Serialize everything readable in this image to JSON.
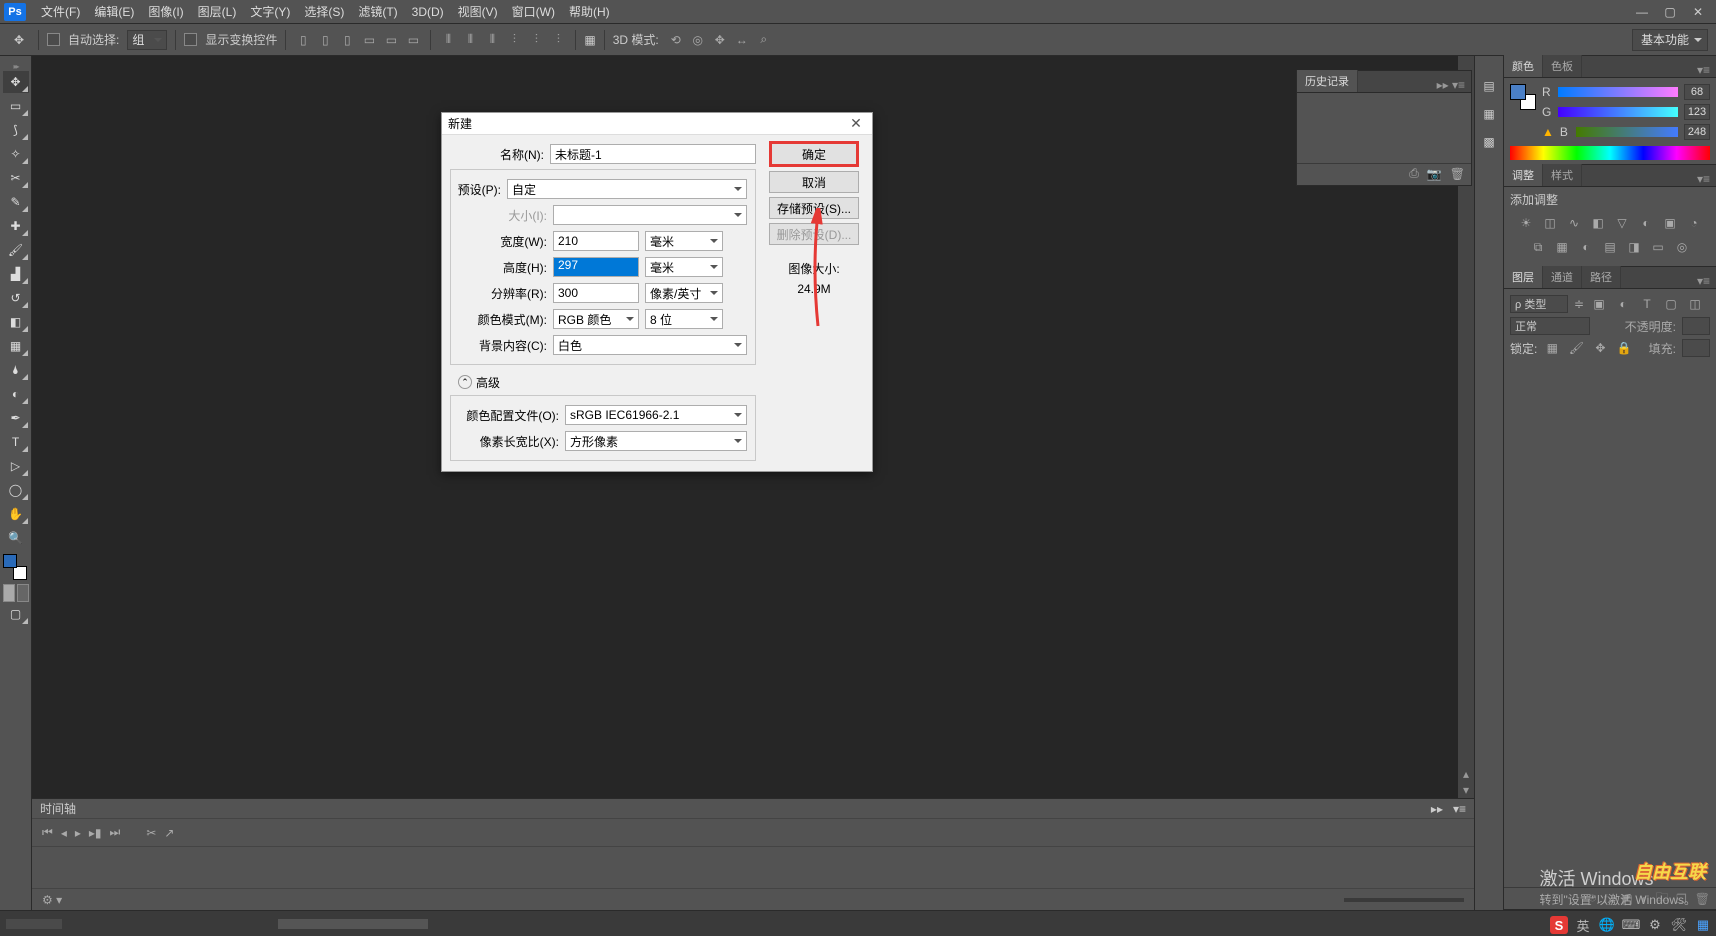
{
  "menubar": {
    "items": [
      "文件(F)",
      "编辑(E)",
      "图像(I)",
      "图层(L)",
      "文字(Y)",
      "选择(S)",
      "滤镜(T)",
      "3D(D)",
      "视图(V)",
      "窗口(W)",
      "帮助(H)"
    ]
  },
  "optbar": {
    "autoSelect": "自动选择:",
    "group": "组",
    "showTransform": "显示变换控件",
    "mode3d": "3D 模式:",
    "workspace": "基本功能"
  },
  "panels": {
    "history": {
      "title": "历史记录"
    },
    "color": {
      "tab1": "颜色",
      "tab2": "色板",
      "r": "R",
      "g": "G",
      "b": "B",
      "rv": "68",
      "gv": "123",
      "bv": "248"
    },
    "adjust": {
      "tab1": "调整",
      "tab2": "样式",
      "hint": "添加调整"
    },
    "layers": {
      "tab1": "图层",
      "tab2": "通道",
      "tab3": "路径",
      "kind": "ρ 类型",
      "blend": "正常",
      "opacity": "不透明度:",
      "lock": "锁定:",
      "fill": "填充:"
    }
  },
  "timeline": {
    "title": "时间轴"
  },
  "dialog": {
    "title": "新建",
    "name": {
      "lbl": "名称(N):",
      "val": "未标题-1"
    },
    "preset": {
      "lbl": "预设(P):",
      "val": "自定"
    },
    "size": {
      "lbl": "大小(I):",
      "val": ""
    },
    "width": {
      "lbl": "宽度(W):",
      "val": "210",
      "unit": "毫米"
    },
    "height": {
      "lbl": "高度(H):",
      "val": "297",
      "unit": "毫米"
    },
    "res": {
      "lbl": "分辨率(R):",
      "val": "300",
      "unit": "像素/英寸"
    },
    "mode": {
      "lbl": "颜色模式(M):",
      "val": "RGB 颜色",
      "bits": "8 位"
    },
    "bg": {
      "lbl": "背景内容(C):",
      "val": "白色"
    },
    "advanced": "高级",
    "profile": {
      "lbl": "颜色配置文件(O):",
      "val": "sRGB IEC61966-2.1"
    },
    "aspect": {
      "lbl": "像素长宽比(X):",
      "val": "方形像素"
    },
    "btn": {
      "ok": "确定",
      "cancel": "取消",
      "save": "存储预设(S)...",
      "delete": "删除预设(D)..."
    },
    "imgSize": {
      "lbl": "图像大小:",
      "val": "24.9M"
    }
  },
  "activate": {
    "t1": "激活 Windows",
    "t2": "转到\"设置\"以激活 Windows。"
  },
  "watermark": "自由互联",
  "tray": {
    "ime": "英"
  }
}
